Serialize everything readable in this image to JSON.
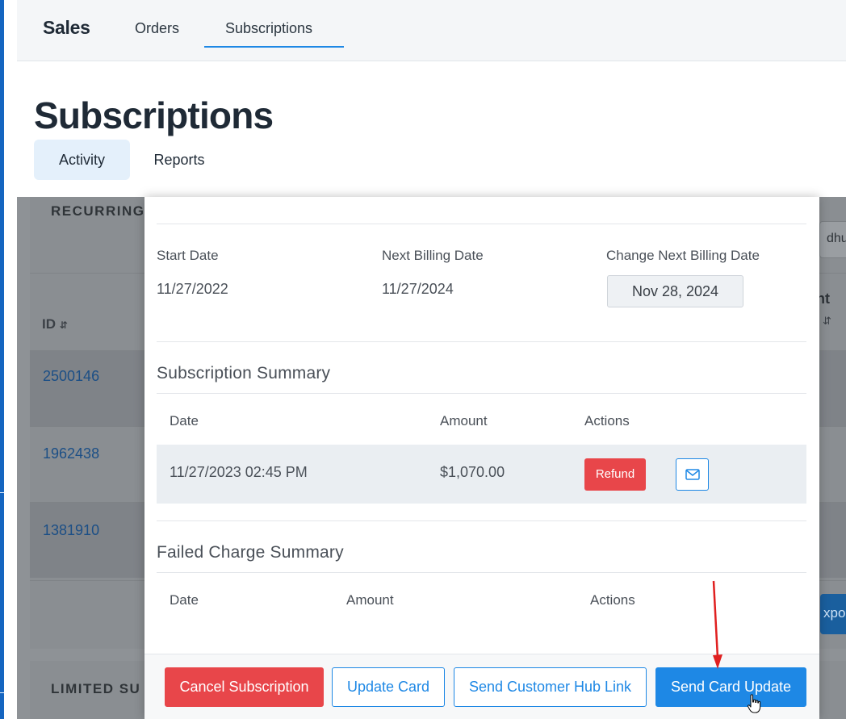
{
  "nav": {
    "brand": "Sales",
    "items": [
      {
        "label": "Orders"
      },
      {
        "label": "Subscriptions"
      }
    ]
  },
  "page": {
    "title": "Subscriptions",
    "tabs": [
      {
        "label": "Activity"
      },
      {
        "label": "Reports"
      }
    ]
  },
  "background": {
    "section_heading": "RECURRING",
    "id_column": "ID",
    "rows": [
      {
        "id": "2500146"
      },
      {
        "id": "1962438"
      },
      {
        "id": "1381910"
      }
    ],
    "filter_fragment": "dhu",
    "amount_fragment": "nt",
    "export_fragment": "xpor",
    "section_heading_2": "LIMITED SU"
  },
  "modal": {
    "start_date_label": "Start Date",
    "start_date_value": "11/27/2022",
    "next_billing_label": "Next Billing Date",
    "next_billing_value": "11/27/2024",
    "change_billing_label": "Change Next Billing Date",
    "change_billing_value": "Nov 28, 2024",
    "subscription_summary": {
      "title": "Subscription Summary",
      "columns": [
        "Date",
        "Amount",
        "Actions"
      ],
      "rows": [
        {
          "date": "11/27/2023 02:45 PM",
          "amount": "$1,070.00",
          "refund_label": "Refund"
        }
      ]
    },
    "failed_summary": {
      "title": "Failed Charge Summary",
      "columns": [
        "Date",
        "Amount",
        "Actions"
      ]
    },
    "footer": {
      "cancel_label": "Cancel Subscription",
      "update_card_label": "Update Card",
      "hub_link_label": "Send Customer Hub Link",
      "send_card_update_label": "Send Card Update"
    }
  },
  "colors": {
    "accent": "#1e88e5",
    "danger": "#e8464a",
    "annotation_arrow": "#e02020"
  },
  "icons": [
    "sort-icon",
    "mail-icon",
    "hand-cursor-icon",
    "annotation-arrow"
  ]
}
